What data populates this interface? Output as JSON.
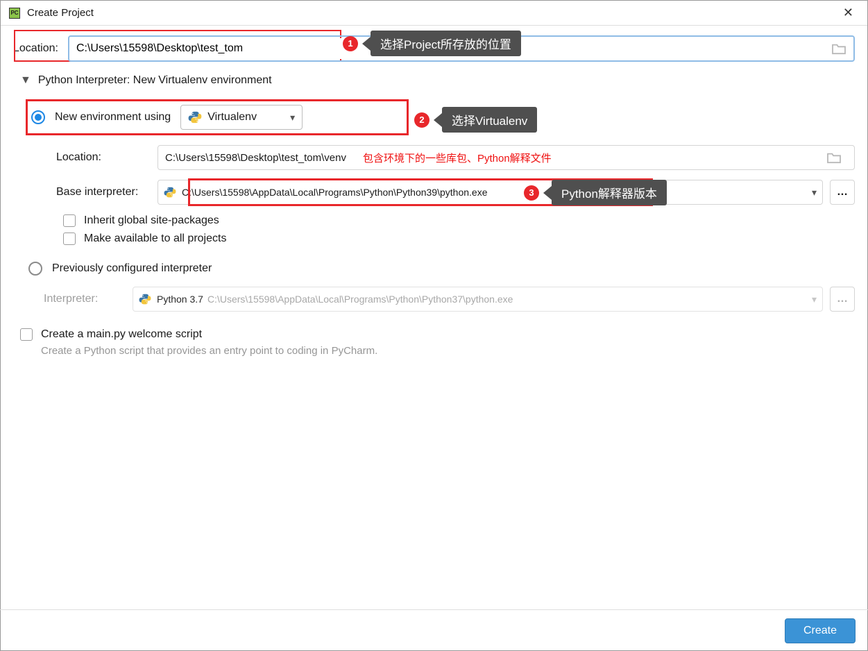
{
  "window": {
    "title": "Create Project"
  },
  "location": {
    "label": "Location:",
    "value": "C:\\Users\\15598\\Desktop\\test_tom"
  },
  "section": {
    "title": "Python Interpreter: New Virtualenv environment"
  },
  "newEnv": {
    "label": "New environment using",
    "dropdown": "Virtualenv",
    "locLabel": "Location:",
    "locValue": "C:\\Users\\15598\\Desktop\\test_tom\\venv",
    "locNote": "包含环境下的一些库包、Python解释文件",
    "baseLabel": "Base interpreter:",
    "baseValue": "C:\\Users\\15598\\AppData\\Local\\Programs\\Python\\Python39\\python.exe",
    "inherit": "Inherit global site-packages",
    "makeAvail": "Make available to all projects"
  },
  "prev": {
    "label": "Previously configured interpreter",
    "interpLabel": "Interpreter:",
    "interpName": "Python 3.7",
    "interpPath": "C:\\Users\\15598\\AppData\\Local\\Programs\\Python\\Python37\\python.exe"
  },
  "mainScript": {
    "label": "Create a main.py welcome script",
    "hint": "Create a Python script that provides an entry point to coding in PyCharm."
  },
  "footer": {
    "create": "Create"
  },
  "callouts": {
    "c1": "选择Project所存放的位置",
    "c2": "选择Virtualenv",
    "c3": "Python解释器版本"
  }
}
